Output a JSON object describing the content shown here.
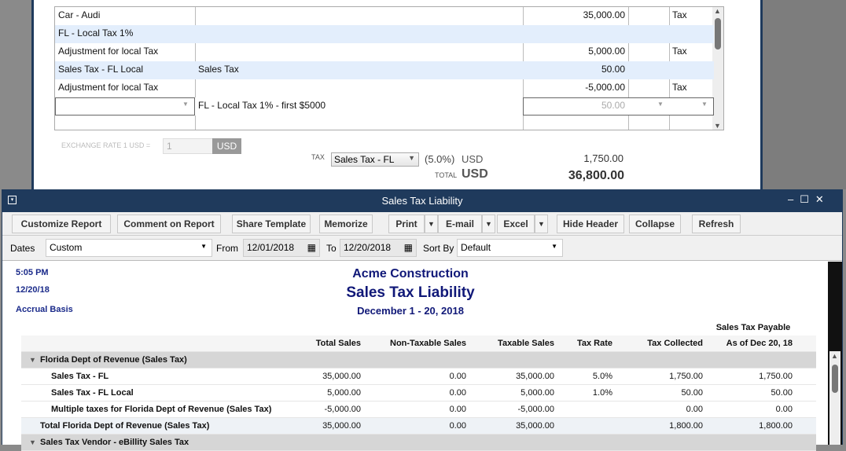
{
  "invoice": {
    "lines": [
      {
        "item": "Car - Audi",
        "desc": "",
        "amount": "35,000.00",
        "tax": "Tax"
      },
      {
        "item": "FL - Local Tax 1%",
        "desc": "",
        "amount": "",
        "tax": ""
      },
      {
        "item": "Adjustment for local Tax",
        "desc": "",
        "amount": "5,000.00",
        "tax": "Tax"
      },
      {
        "item": "Sales Tax - FL Local",
        "desc": "Sales Tax",
        "amount": "50.00",
        "tax": ""
      },
      {
        "item": "Adjustment for local Tax",
        "desc": "",
        "amount": "-5,000.00",
        "tax": "Tax"
      },
      {
        "item": "",
        "desc": "FL - Local Tax 1% - first $5000",
        "amount": "50.00",
        "tax": ""
      }
    ],
    "exchange_label": "EXCHANGE RATE 1 USD =",
    "exchange_value": "1",
    "exchange_currency": "USD",
    "tax_label": "TAX",
    "tax_select": "Sales Tax - FL",
    "tax_rate": "(5.0%)",
    "tax_currency": "USD",
    "tax_amount": "1,750.00",
    "total_label": "TOTAL",
    "total_currency": "USD",
    "total_amount": "36,800.00"
  },
  "window": {
    "title": "Sales Tax Liability"
  },
  "toolbar": {
    "customize": "Customize Report",
    "comment": "Comment on Report",
    "share": "Share Template",
    "memorize": "Memorize",
    "print": "Print",
    "email": "E-mail",
    "excel": "Excel",
    "hide_header": "Hide Header",
    "collapse": "Collapse",
    "refresh": "Refresh"
  },
  "filters": {
    "dates_label": "Dates",
    "dates_value": "Custom",
    "from_label": "From",
    "from_value": "12/01/2018",
    "to_label": "To",
    "to_value": "12/20/2018",
    "sortby_label": "Sort By",
    "sortby_value": "Default"
  },
  "report": {
    "time": "5:05 PM",
    "date": "12/20/18",
    "basis": "Accrual Basis",
    "company": "Acme Construction",
    "title": "Sales Tax Liability",
    "period": "December 1 - 20, 2018",
    "super_header": "Sales Tax Payable",
    "columns": [
      "Total Sales",
      "Non-Taxable Sales",
      "Taxable Sales",
      "Tax Rate",
      "Tax Collected",
      "As of Dec 20, 18"
    ],
    "group1": "Florida Dept of Revenue (Sales Tax)",
    "rows": [
      {
        "name": "Sales Tax - FL",
        "v": [
          "35,000.00",
          "0.00",
          "35,000.00",
          "5.0%",
          "1,750.00",
          "1,750.00"
        ]
      },
      {
        "name": "Sales Tax - FL Local",
        "v": [
          "5,000.00",
          "0.00",
          "5,000.00",
          "1.0%",
          "50.00",
          "50.00"
        ]
      },
      {
        "name": "Multiple taxes for Florida Dept of Revenue (Sales Tax)",
        "v": [
          "-5,000.00",
          "0.00",
          "-5,000.00",
          "",
          "0.00",
          "0.00"
        ]
      }
    ],
    "total": {
      "name": "Total Florida Dept of Revenue (Sales Tax)",
      "v": [
        "35,000.00",
        "0.00",
        "35,000.00",
        "",
        "1,800.00",
        "1,800.00"
      ]
    },
    "group2": "Sales Tax Vendor - eBillity Sales Tax"
  }
}
